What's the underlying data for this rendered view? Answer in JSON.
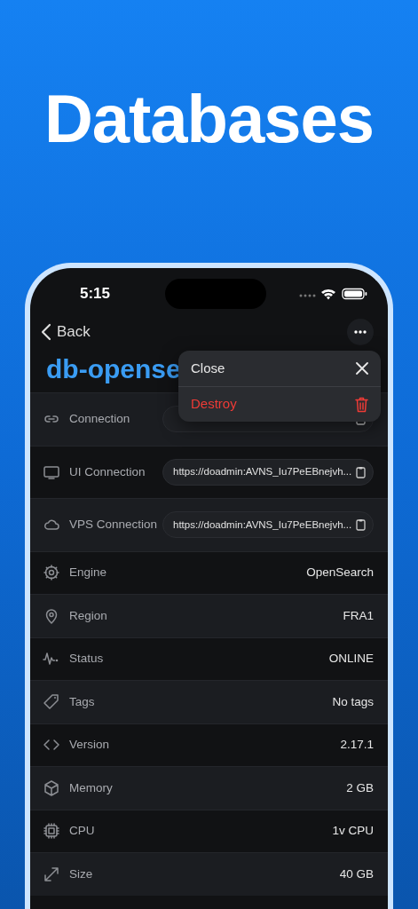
{
  "headline": "Databases",
  "status_bar": {
    "time": "5:15"
  },
  "nav": {
    "back": "Back"
  },
  "title": "db-opense",
  "menu": [
    {
      "kind": "close",
      "label": "Close"
    },
    {
      "kind": "destroy",
      "label": "Destroy"
    }
  ],
  "rows": [
    {
      "kind": "link",
      "label": "Connection"
    },
    {
      "kind": "link",
      "label": "UI Connection",
      "value": "https://doadmin:AVNS_Iu7PeEBnejvh..."
    },
    {
      "kind": "link",
      "label": "VPS Connection",
      "value": "https://doadmin:AVNS_Iu7PeEBnejvh..."
    },
    {
      "kind": "info",
      "label": "Engine",
      "value": "OpenSearch"
    },
    {
      "kind": "info",
      "label": "Region",
      "value": "FRA1"
    },
    {
      "kind": "info",
      "label": "Status",
      "value": "ONLINE"
    },
    {
      "kind": "info",
      "label": "Tags",
      "value": "No tags"
    },
    {
      "kind": "info",
      "label": "Version",
      "value": "2.17.1"
    },
    {
      "kind": "info",
      "label": "Memory",
      "value": "2 GB"
    },
    {
      "kind": "info",
      "label": "CPU",
      "value": "1v CPU"
    },
    {
      "kind": "info",
      "label": "Size",
      "value": "40 GB"
    }
  ]
}
